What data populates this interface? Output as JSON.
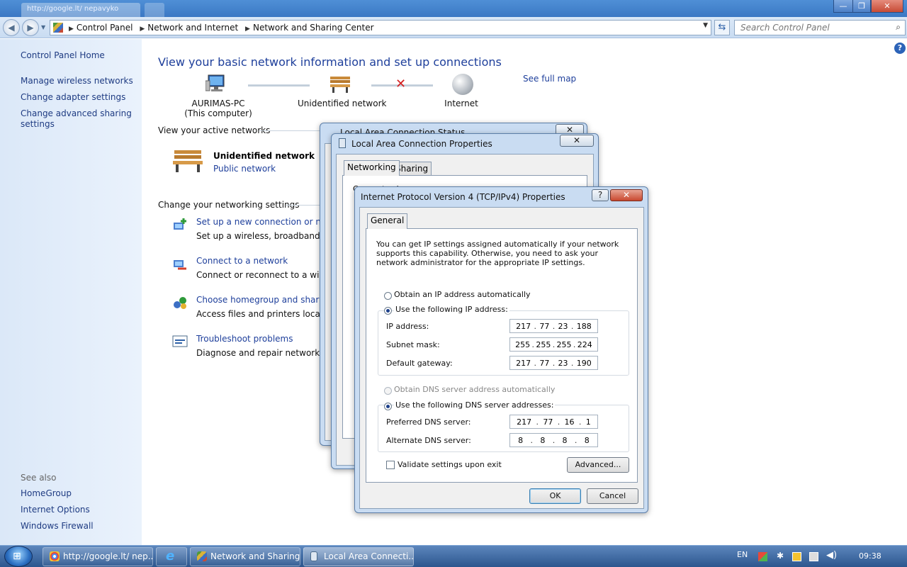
{
  "browser_tab": {
    "title": "http://google.lt/ nepavyko"
  },
  "window_controls": {
    "minimize": "—",
    "maximize": "❐",
    "close": "✕"
  },
  "address": {
    "crumbs": [
      "Control Panel",
      "Network and Internet",
      "Network and Sharing Center"
    ],
    "search_placeholder": "Search Control Panel"
  },
  "left_pane": {
    "home": "Control Panel Home",
    "links": [
      "Manage wireless networks",
      "Change adapter settings",
      "Change advanced sharing",
      "settings"
    ],
    "see_also": "See also",
    "see_also_links": [
      "HomeGroup",
      "Internet Options",
      "Windows Firewall"
    ]
  },
  "main": {
    "heading": "View your basic network information and set up connections",
    "see_full_map": "See full map",
    "map": {
      "computer": "AURIMAS-PC",
      "computer_sub": "(This computer)",
      "network": "Unidentified network",
      "internet": "Internet"
    },
    "active_networks": "View your active networks",
    "active_network_name": "Unidentified network",
    "active_network_type": "Public network",
    "change_settings": "Change your networking settings",
    "tasks": [
      {
        "title": "Set up a new connection or netw",
        "desc": "Set up a wireless, broadband, dial"
      },
      {
        "title": "Connect to a network",
        "desc": "Connect or reconnect to a wireles"
      },
      {
        "title": "Choose homegroup and sharing",
        "desc": "Access files and printers located o"
      },
      {
        "title": "Troubleshoot problems",
        "desc": "Diagnose and repair network prol"
      }
    ]
  },
  "lac_status": {
    "title": "Local Area Connection Status"
  },
  "lac_props": {
    "title": "Local Area Connection Properties",
    "tabs": [
      "Networking",
      "Sharing"
    ],
    "conn_label": "Connect using:"
  },
  "ipv4": {
    "title": "Internet Protocol Version 4 (TCP/IPv4) Properties",
    "help": "?",
    "close": "✕",
    "tab": "General",
    "intro": "You can get IP settings assigned automatically if your network supports this capability. Otherwise, you need to ask your network administrator for the appropriate IP settings.",
    "obtain_ip": "Obtain an IP address automatically",
    "use_ip": "Use the following IP address:",
    "ip_label": "IP address:",
    "ip": [
      "217",
      "77",
      "23",
      "188"
    ],
    "mask_label": "Subnet mask:",
    "mask": [
      "255",
      "255",
      "255",
      "224"
    ],
    "gateway_label": "Default gateway:",
    "gateway": [
      "217",
      "77",
      "23",
      "190"
    ],
    "obtain_dns": "Obtain DNS server address automatically",
    "use_dns": "Use the following DNS server addresses:",
    "pref_dns_label": "Preferred DNS server:",
    "pref_dns": [
      "217",
      "77",
      "16",
      "1"
    ],
    "alt_dns_label": "Alternate DNS server:",
    "alt_dns": [
      "8",
      "8",
      "8",
      "8"
    ],
    "validate": "Validate settings upon exit",
    "advanced": "Advanced...",
    "ok": "OK",
    "cancel": "Cancel"
  },
  "taskbar": {
    "items": [
      "http://google.lt/ nep...",
      "Network and Sharing...",
      "Local Area Connecti..."
    ],
    "lang": "EN",
    "clock": "09:38"
  }
}
